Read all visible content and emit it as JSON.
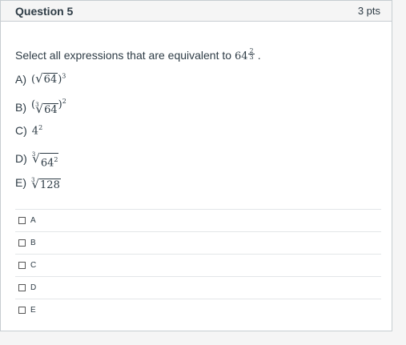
{
  "question": {
    "title": "Question 5",
    "points": "3 pts"
  },
  "prompt": {
    "text": "Select all expressions that are equivalent to",
    "base": "64",
    "exp_num": "2",
    "exp_den": "3",
    "trail": "."
  },
  "expressions": [
    {
      "label": "A)",
      "radicand": "64",
      "outer_exp": "3",
      "index": ""
    },
    {
      "label": "B)",
      "radicand": "64",
      "outer_exp": "2",
      "index": "3"
    },
    {
      "label": "C)",
      "base": "4",
      "exp": "2"
    },
    {
      "label": "D)",
      "radicand_base": "64",
      "radicand_exp": "2",
      "index": "3"
    },
    {
      "label": "E)",
      "radicand": "128",
      "index": "3"
    }
  ],
  "options": [
    {
      "label": "A"
    },
    {
      "label": "B"
    },
    {
      "label": "C"
    },
    {
      "label": "D"
    },
    {
      "label": "E"
    }
  ]
}
